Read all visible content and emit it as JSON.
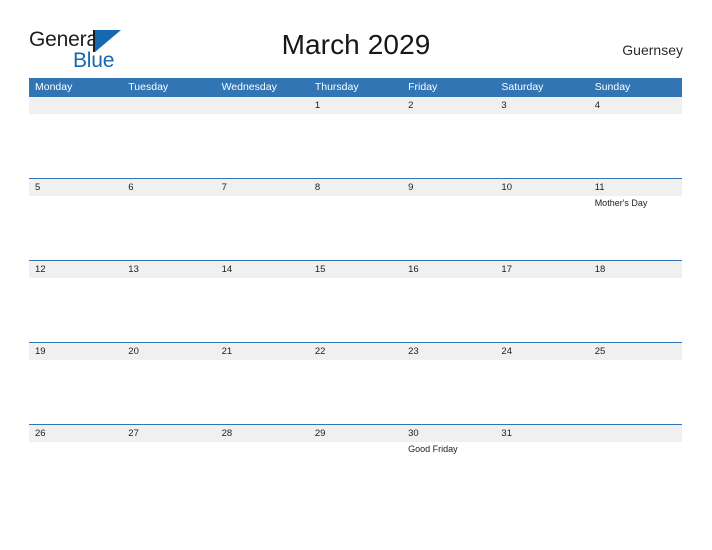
{
  "brand": {
    "name_part1": "General",
    "name_part2": "Blue",
    "color_dark": "#1d1d1b",
    "color_blue": "#1668b0"
  },
  "header": {
    "month_title": "March 2029",
    "locale": "Guernsey"
  },
  "theme": {
    "header_blue": "#3275b5",
    "date_band_gray": "#f0f0f0",
    "separator_blue": "#3275b5"
  },
  "calendar": {
    "weekdays": [
      "Monday",
      "Tuesday",
      "Wednesday",
      "Thursday",
      "Friday",
      "Saturday",
      "Sunday"
    ],
    "weeks": [
      {
        "days": [
          {
            "number": "",
            "events": []
          },
          {
            "number": "",
            "events": []
          },
          {
            "number": "",
            "events": []
          },
          {
            "number": "1",
            "events": []
          },
          {
            "number": "2",
            "events": []
          },
          {
            "number": "3",
            "events": []
          },
          {
            "number": "4",
            "events": []
          }
        ]
      },
      {
        "days": [
          {
            "number": "5",
            "events": []
          },
          {
            "number": "6",
            "events": []
          },
          {
            "number": "7",
            "events": []
          },
          {
            "number": "8",
            "events": []
          },
          {
            "number": "9",
            "events": []
          },
          {
            "number": "10",
            "events": []
          },
          {
            "number": "11",
            "events": [
              "Mother's Day"
            ]
          }
        ]
      },
      {
        "days": [
          {
            "number": "12",
            "events": []
          },
          {
            "number": "13",
            "events": []
          },
          {
            "number": "14",
            "events": []
          },
          {
            "number": "15",
            "events": []
          },
          {
            "number": "16",
            "events": []
          },
          {
            "number": "17",
            "events": []
          },
          {
            "number": "18",
            "events": []
          }
        ]
      },
      {
        "days": [
          {
            "number": "19",
            "events": []
          },
          {
            "number": "20",
            "events": []
          },
          {
            "number": "21",
            "events": []
          },
          {
            "number": "22",
            "events": []
          },
          {
            "number": "23",
            "events": []
          },
          {
            "number": "24",
            "events": []
          },
          {
            "number": "25",
            "events": []
          }
        ]
      },
      {
        "days": [
          {
            "number": "26",
            "events": []
          },
          {
            "number": "27",
            "events": []
          },
          {
            "number": "28",
            "events": []
          },
          {
            "number": "29",
            "events": []
          },
          {
            "number": "30",
            "events": [
              "Good Friday"
            ]
          },
          {
            "number": "31",
            "events": []
          },
          {
            "number": "",
            "events": []
          }
        ]
      }
    ]
  }
}
